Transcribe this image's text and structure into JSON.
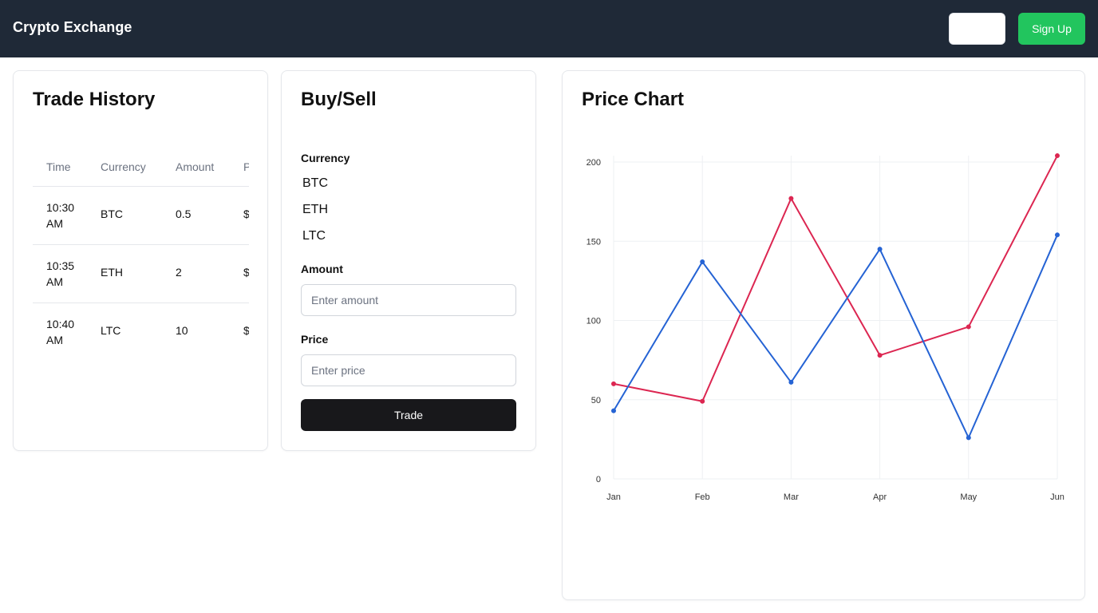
{
  "header": {
    "title": "Crypto Exchange",
    "login_label": "",
    "signup_label": "Sign Up"
  },
  "history": {
    "title": "Trade History",
    "columns": [
      "Time",
      "Currency",
      "Amount",
      "P"
    ],
    "rows": [
      {
        "time": "10:30 AM",
        "currency": "BTC",
        "amount": "0.5",
        "price": "$"
      },
      {
        "time": "10:35 AM",
        "currency": "ETH",
        "amount": "2",
        "price": "$"
      },
      {
        "time": "10:40 AM",
        "currency": "LTC",
        "amount": "10",
        "price": "$"
      }
    ]
  },
  "trade": {
    "title": "Buy/Sell",
    "currency_label": "Currency",
    "currency_options": [
      "BTC",
      "ETH",
      "LTC"
    ],
    "amount_label": "Amount",
    "amount_placeholder": "Enter amount",
    "price_label": "Price",
    "price_placeholder": "Enter price",
    "submit_label": "Trade"
  },
  "chart": {
    "title": "Price Chart"
  },
  "chart_data": {
    "type": "line",
    "categories": [
      "Jan",
      "Feb",
      "Mar",
      "Apr",
      "May",
      "Jun"
    ],
    "series": [
      {
        "values": [
          60,
          49,
          177,
          78,
          96,
          204
        ],
        "color": "#dc2651"
      },
      {
        "values": [
          43,
          137,
          61,
          145,
          26,
          154
        ],
        "color": "#2563d4"
      }
    ],
    "ylim": [
      0,
      200
    ],
    "yticks": [
      0,
      50,
      100,
      150,
      200
    ],
    "grid": true
  }
}
